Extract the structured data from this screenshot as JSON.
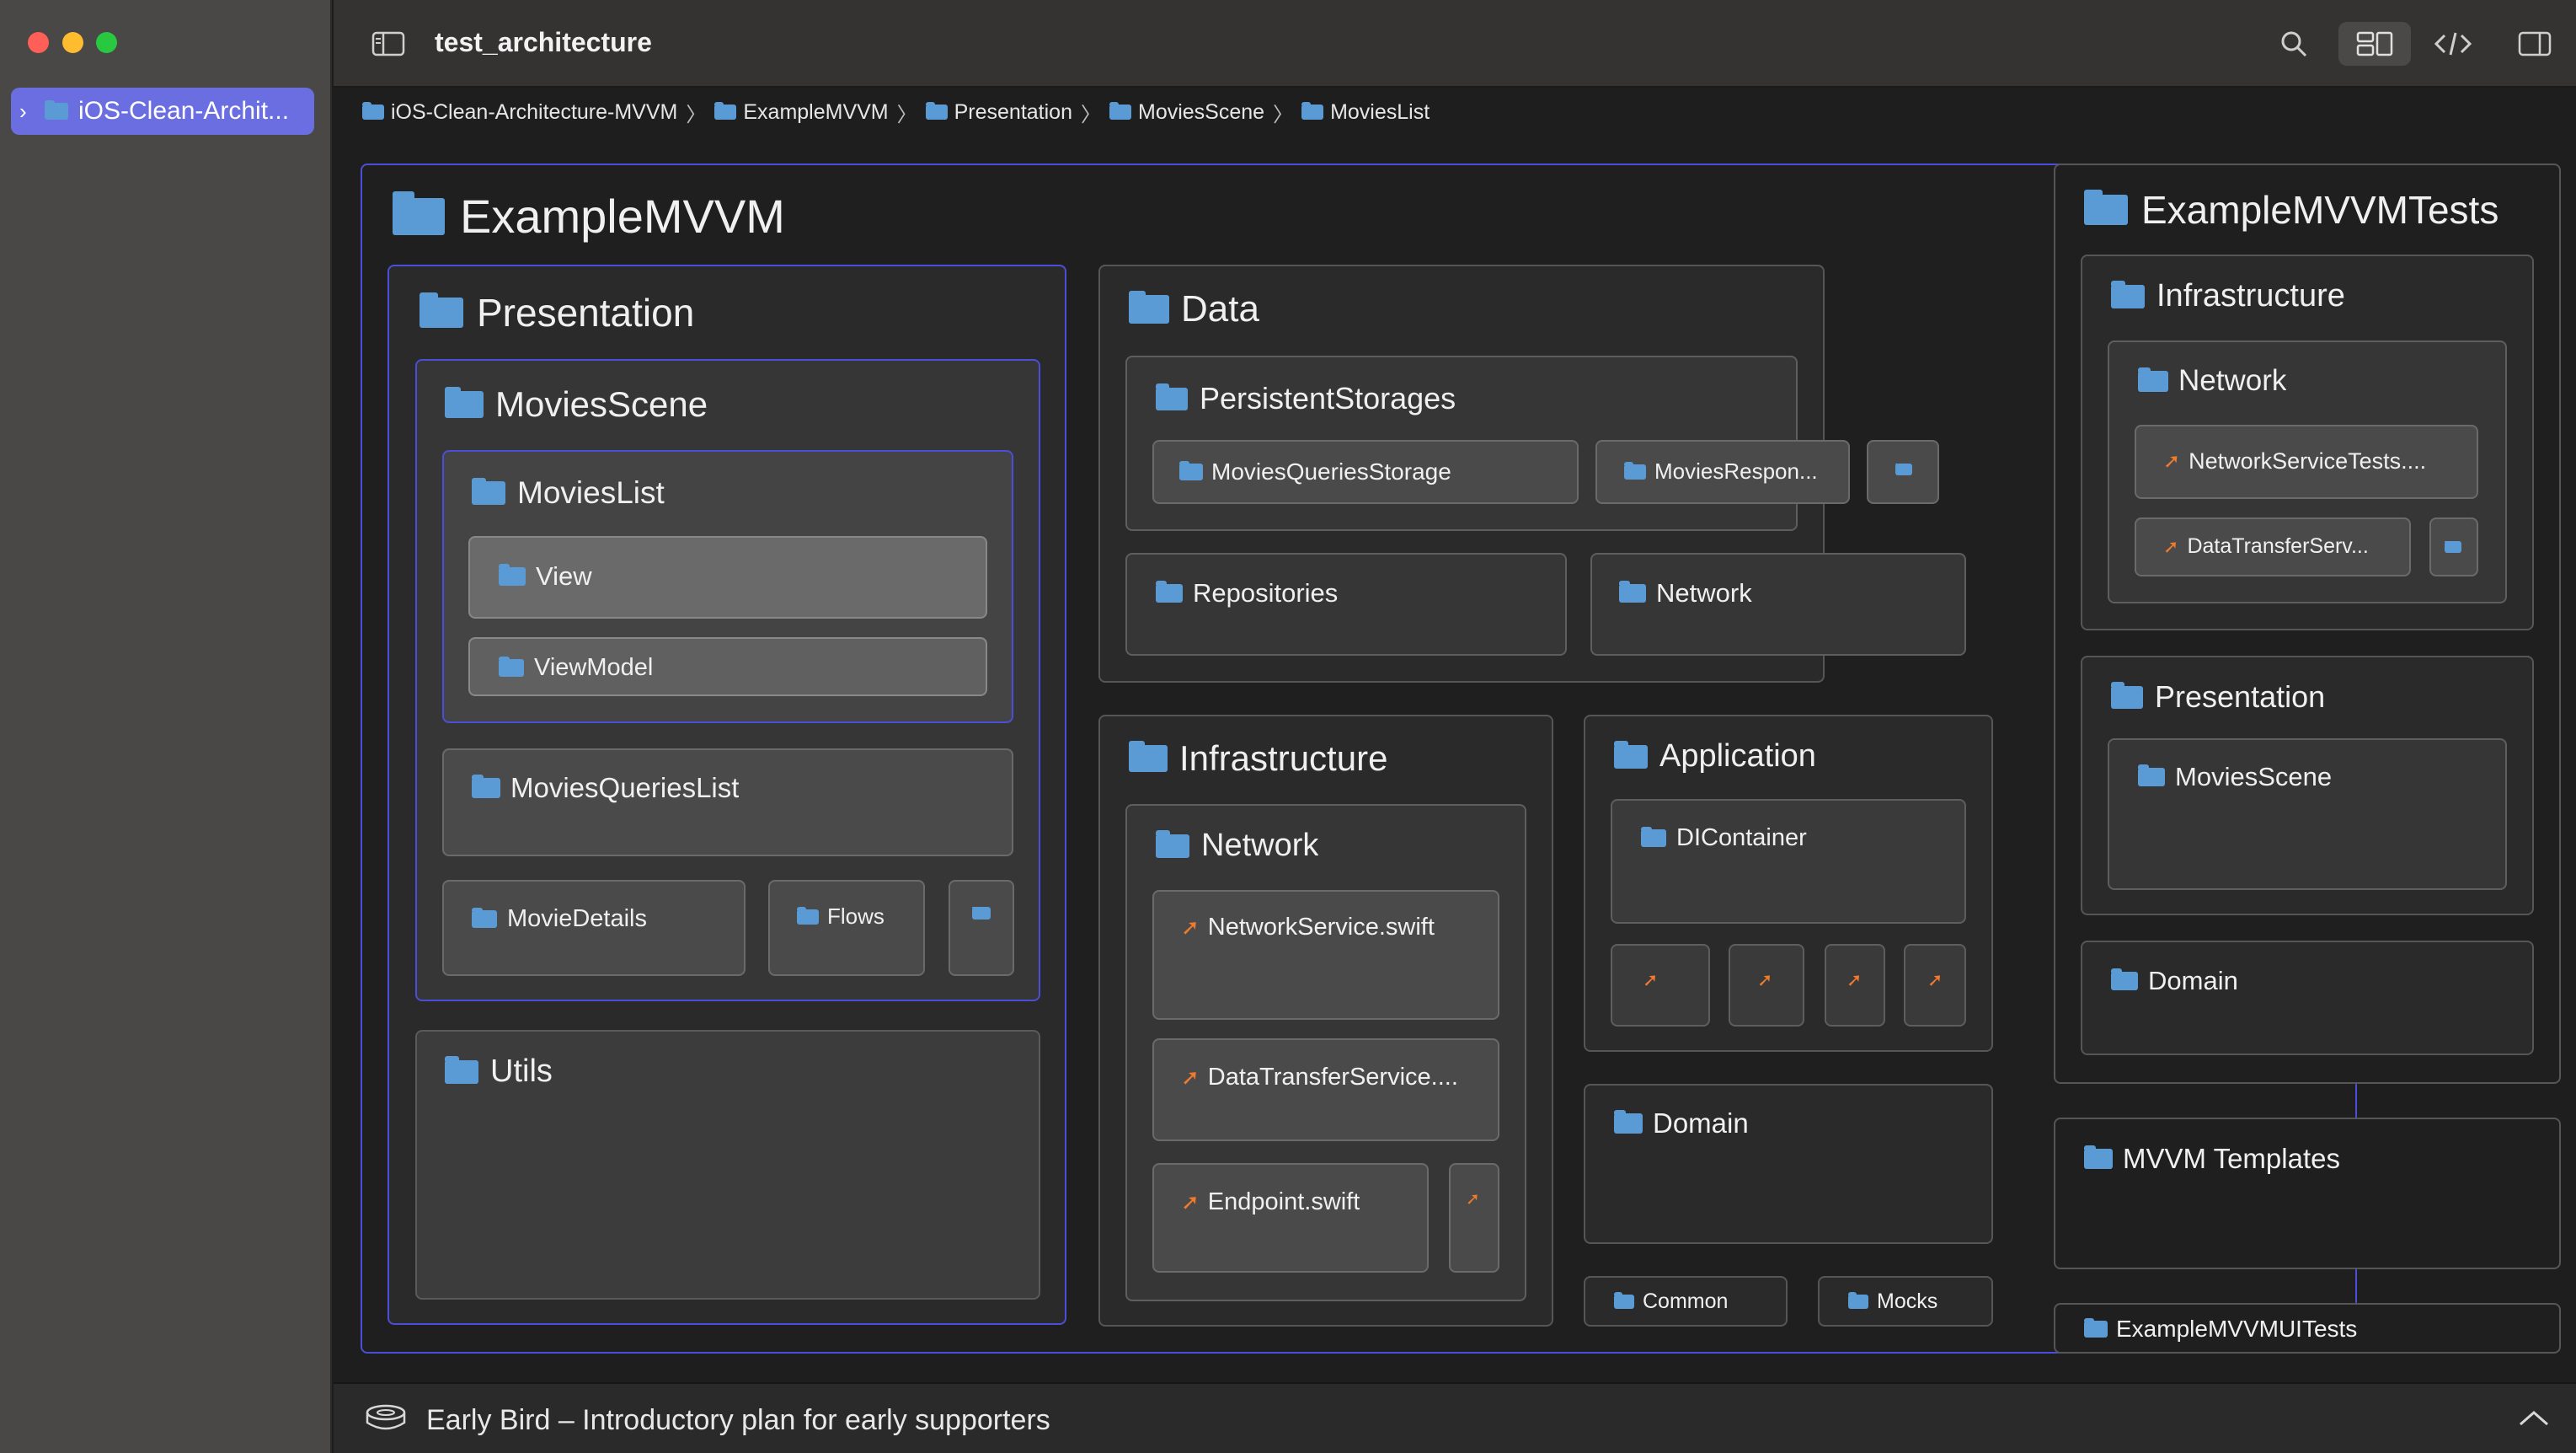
{
  "window": {
    "title": "test_architecture"
  },
  "sidebar": {
    "items": [
      {
        "label": "iOS-Clean-Archit..."
      }
    ]
  },
  "toolbar": {
    "icons": [
      "sidebar-toggle-icon",
      "search-icon",
      "diagram-view-icon",
      "code-icon",
      "inspector-toggle-icon"
    ]
  },
  "breadcrumb": [
    "iOS-Clean-Architecture-MVVM",
    "ExampleMVVM",
    "Presentation",
    "MoviesScene",
    "MoviesList"
  ],
  "diagram": {
    "example_mvvm": "ExampleMVVM",
    "presentation": "Presentation",
    "movies_scene": "MoviesScene",
    "movies_list": "MoviesList",
    "view": "View",
    "view_model": "ViewModel",
    "movies_queries_list": "MoviesQueriesList",
    "movie_details": "MovieDetails",
    "flows": "Flows",
    "utils": "Utils",
    "data": "Data",
    "persistent_storages": "PersistentStorages",
    "movies_queries_storage": "MoviesQueriesStorage",
    "movies_respon": "MoviesRespon...",
    "repositories": "Repositories",
    "data_network": "Network",
    "infrastructure": "Infrastructure",
    "infra_network": "Network",
    "network_service": "NetworkService.swift",
    "data_transfer_service": "DataTransferService....",
    "endpoint": "Endpoint.swift",
    "application": "Application",
    "di_container": "DIContainer",
    "domain": "Domain",
    "common": "Common",
    "mocks": "Mocks",
    "tests": "ExampleMVVMTests",
    "tests_infrastructure": "Infrastructure",
    "tests_network": "Network",
    "network_service_tests": "NetworkServiceTests....",
    "data_transfer_serv": "DataTransferServ...",
    "tests_presentation": "Presentation",
    "tests_movies_scene": "MoviesScene",
    "tests_domain": "Domain",
    "mvvm_templates": "MVVM Templates",
    "ui_tests": "ExampleMVVMUITests"
  },
  "colors": {
    "folder": "#5b9bd5",
    "swift": "#f07b2c",
    "selection": "#4b4fd8",
    "sidebar_selected": "#6a6ee0"
  },
  "bottom_bar": {
    "text": "Early Bird – Introductory plan for early supporters"
  }
}
